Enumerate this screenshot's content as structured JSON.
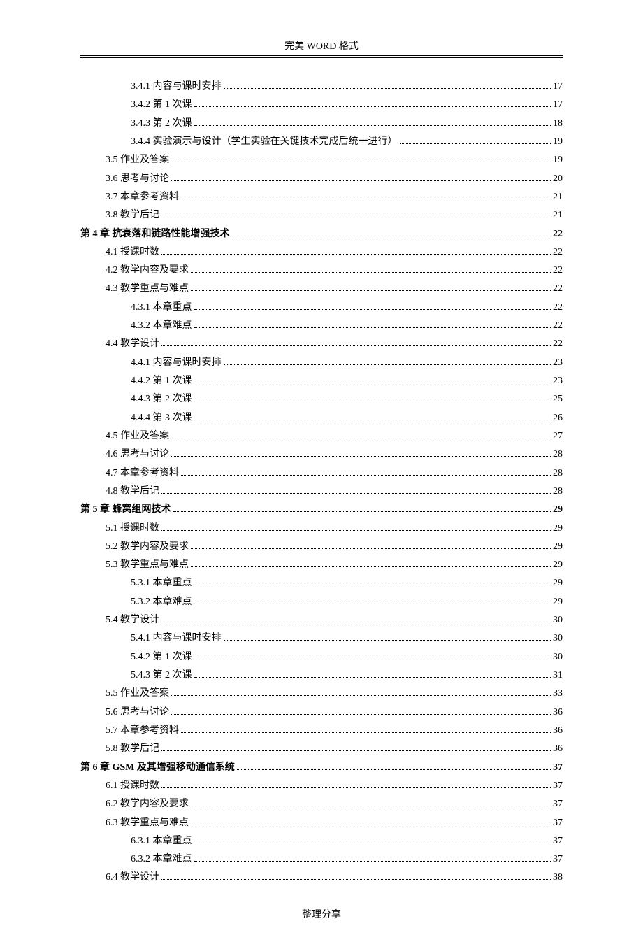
{
  "header": "完美 WORD 格式",
  "footer": "整理分享",
  "toc": [
    {
      "level": 3,
      "bold": false,
      "label": "3.4.1  内容与课时安排",
      "page": "17"
    },
    {
      "level": 3,
      "bold": false,
      "label": "3.4.2  第 1 次课",
      "page": "17"
    },
    {
      "level": 3,
      "bold": false,
      "label": "3.4.3  第 2 次课",
      "page": "18"
    },
    {
      "level": 3,
      "bold": false,
      "label": "3.4.4  实验演示与设计（学生实验在关键技术完成后统一进行）",
      "page": "19"
    },
    {
      "level": 2,
      "bold": false,
      "label": "3.5  作业及答案",
      "page": "19"
    },
    {
      "level": 2,
      "bold": false,
      "label": "3.6  思考与讨论",
      "page": "20"
    },
    {
      "level": 2,
      "bold": false,
      "label": "3.7  本章参考资料",
      "page": "21"
    },
    {
      "level": 2,
      "bold": false,
      "label": "3.8  教学后记",
      "page": "21"
    },
    {
      "level": 1,
      "bold": true,
      "label": "第  4  章  抗衰落和链路性能增强技术 ",
      "page": "22"
    },
    {
      "level": 2,
      "bold": false,
      "label": "4.1  授课时数",
      "page": "22"
    },
    {
      "level": 2,
      "bold": false,
      "label": "4.2  教学内容及要求",
      "page": "22"
    },
    {
      "level": 2,
      "bold": false,
      "label": "4.3  教学重点与难点",
      "page": "22"
    },
    {
      "level": 3,
      "bold": false,
      "label": "4.3.1  本章重点",
      "page": "22"
    },
    {
      "level": 3,
      "bold": false,
      "label": "4.3.2  本章难点",
      "page": "22"
    },
    {
      "level": 2,
      "bold": false,
      "label": "4.4  教学设计",
      "page": "22"
    },
    {
      "level": 3,
      "bold": false,
      "label": "4.4.1  内容与课时安排",
      "page": "23"
    },
    {
      "level": 3,
      "bold": false,
      "label": "4.4.2  第 1 次课",
      "page": "23"
    },
    {
      "level": 3,
      "bold": false,
      "label": "4.4.3  第 2 次课",
      "page": "25"
    },
    {
      "level": 3,
      "bold": false,
      "label": "4.4.4  第 3 次课",
      "page": "26"
    },
    {
      "level": 2,
      "bold": false,
      "label": "4.5  作业及答案",
      "page": "27"
    },
    {
      "level": 2,
      "bold": false,
      "label": "4.6  思考与讨论",
      "page": "28"
    },
    {
      "level": 2,
      "bold": false,
      "label": "4.7  本章参考资料",
      "page": "28"
    },
    {
      "level": 2,
      "bold": false,
      "label": "4.8  教学后记",
      "page": "28"
    },
    {
      "level": 1,
      "bold": true,
      "label": "第  5  章  蜂窝组网技术 ",
      "page": "29"
    },
    {
      "level": 2,
      "bold": false,
      "label": "5.1  授课时数",
      "page": "29"
    },
    {
      "level": 2,
      "bold": false,
      "label": "5.2  教学内容及要求",
      "page": "29"
    },
    {
      "level": 2,
      "bold": false,
      "label": "5.3  教学重点与难点",
      "page": "29"
    },
    {
      "level": 3,
      "bold": false,
      "label": "5.3.1  本章重点",
      "page": "29"
    },
    {
      "level": 3,
      "bold": false,
      "label": "5.3.2  本章难点",
      "page": "29"
    },
    {
      "level": 2,
      "bold": false,
      "label": "5.4  教学设计",
      "page": "30"
    },
    {
      "level": 3,
      "bold": false,
      "label": "5.4.1  内容与课时安排",
      "page": "30"
    },
    {
      "level": 3,
      "bold": false,
      "label": "5.4.2  第 1 次课",
      "page": "30"
    },
    {
      "level": 3,
      "bold": false,
      "label": "5.4.3  第 2 次课",
      "page": "31"
    },
    {
      "level": 2,
      "bold": false,
      "label": "5.5  作业及答案",
      "page": "33"
    },
    {
      "level": 2,
      "bold": false,
      "label": "5.6  思考与讨论",
      "page": "36"
    },
    {
      "level": 2,
      "bold": false,
      "label": "5.7  本章参考资料",
      "page": "36"
    },
    {
      "level": 2,
      "bold": false,
      "label": "5.8  教学后记",
      "page": "36"
    },
    {
      "level": 1,
      "bold": true,
      "label": "第  6  章  GSM 及其增强移动通信系统 ",
      "page": "37"
    },
    {
      "level": 2,
      "bold": false,
      "label": "6.1  授课时数",
      "page": "37"
    },
    {
      "level": 2,
      "bold": false,
      "label": "6.2  教学内容及要求",
      "page": "37"
    },
    {
      "level": 2,
      "bold": false,
      "label": "6.3  教学重点与难点",
      "page": "37"
    },
    {
      "level": 3,
      "bold": false,
      "label": "6.3.1  本章重点",
      "page": "37"
    },
    {
      "level": 3,
      "bold": false,
      "label": "6.3.2  本章难点",
      "page": "37"
    },
    {
      "level": 2,
      "bold": false,
      "label": "6.4  教学设计",
      "page": "38"
    }
  ]
}
